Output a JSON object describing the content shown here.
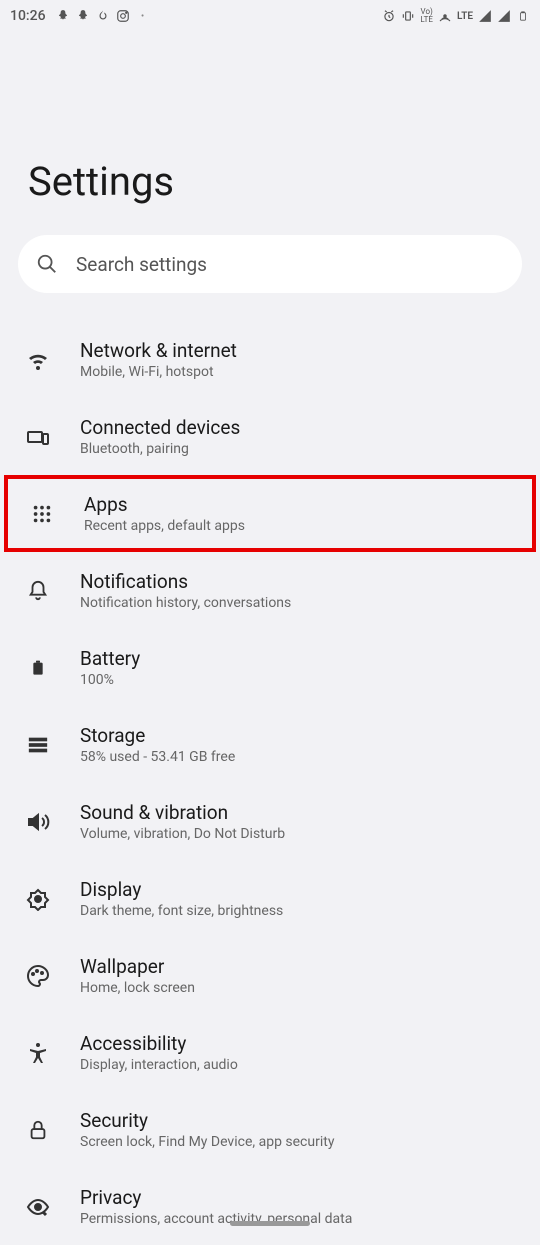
{
  "status": {
    "time": "10:26",
    "lte": "LTE"
  },
  "page": {
    "title": "Settings"
  },
  "search": {
    "placeholder": "Search settings"
  },
  "items": [
    {
      "label": "Network & internet",
      "sub": "Mobile, Wi-Fi, hotspot"
    },
    {
      "label": "Connected devices",
      "sub": "Bluetooth, pairing"
    },
    {
      "label": "Apps",
      "sub": "Recent apps, default apps"
    },
    {
      "label": "Notifications",
      "sub": "Notification history, conversations"
    },
    {
      "label": "Battery",
      "sub": "100%"
    },
    {
      "label": "Storage",
      "sub": "58% used - 53.41 GB free"
    },
    {
      "label": "Sound & vibration",
      "sub": "Volume, vibration, Do Not Disturb"
    },
    {
      "label": "Display",
      "sub": "Dark theme, font size, brightness"
    },
    {
      "label": "Wallpaper",
      "sub": "Home, lock screen"
    },
    {
      "label": "Accessibility",
      "sub": "Display, interaction, audio"
    },
    {
      "label": "Security",
      "sub": "Screen lock, Find My Device, app security"
    },
    {
      "label": "Privacy",
      "sub": "Permissions, account activity, personal data"
    }
  ]
}
